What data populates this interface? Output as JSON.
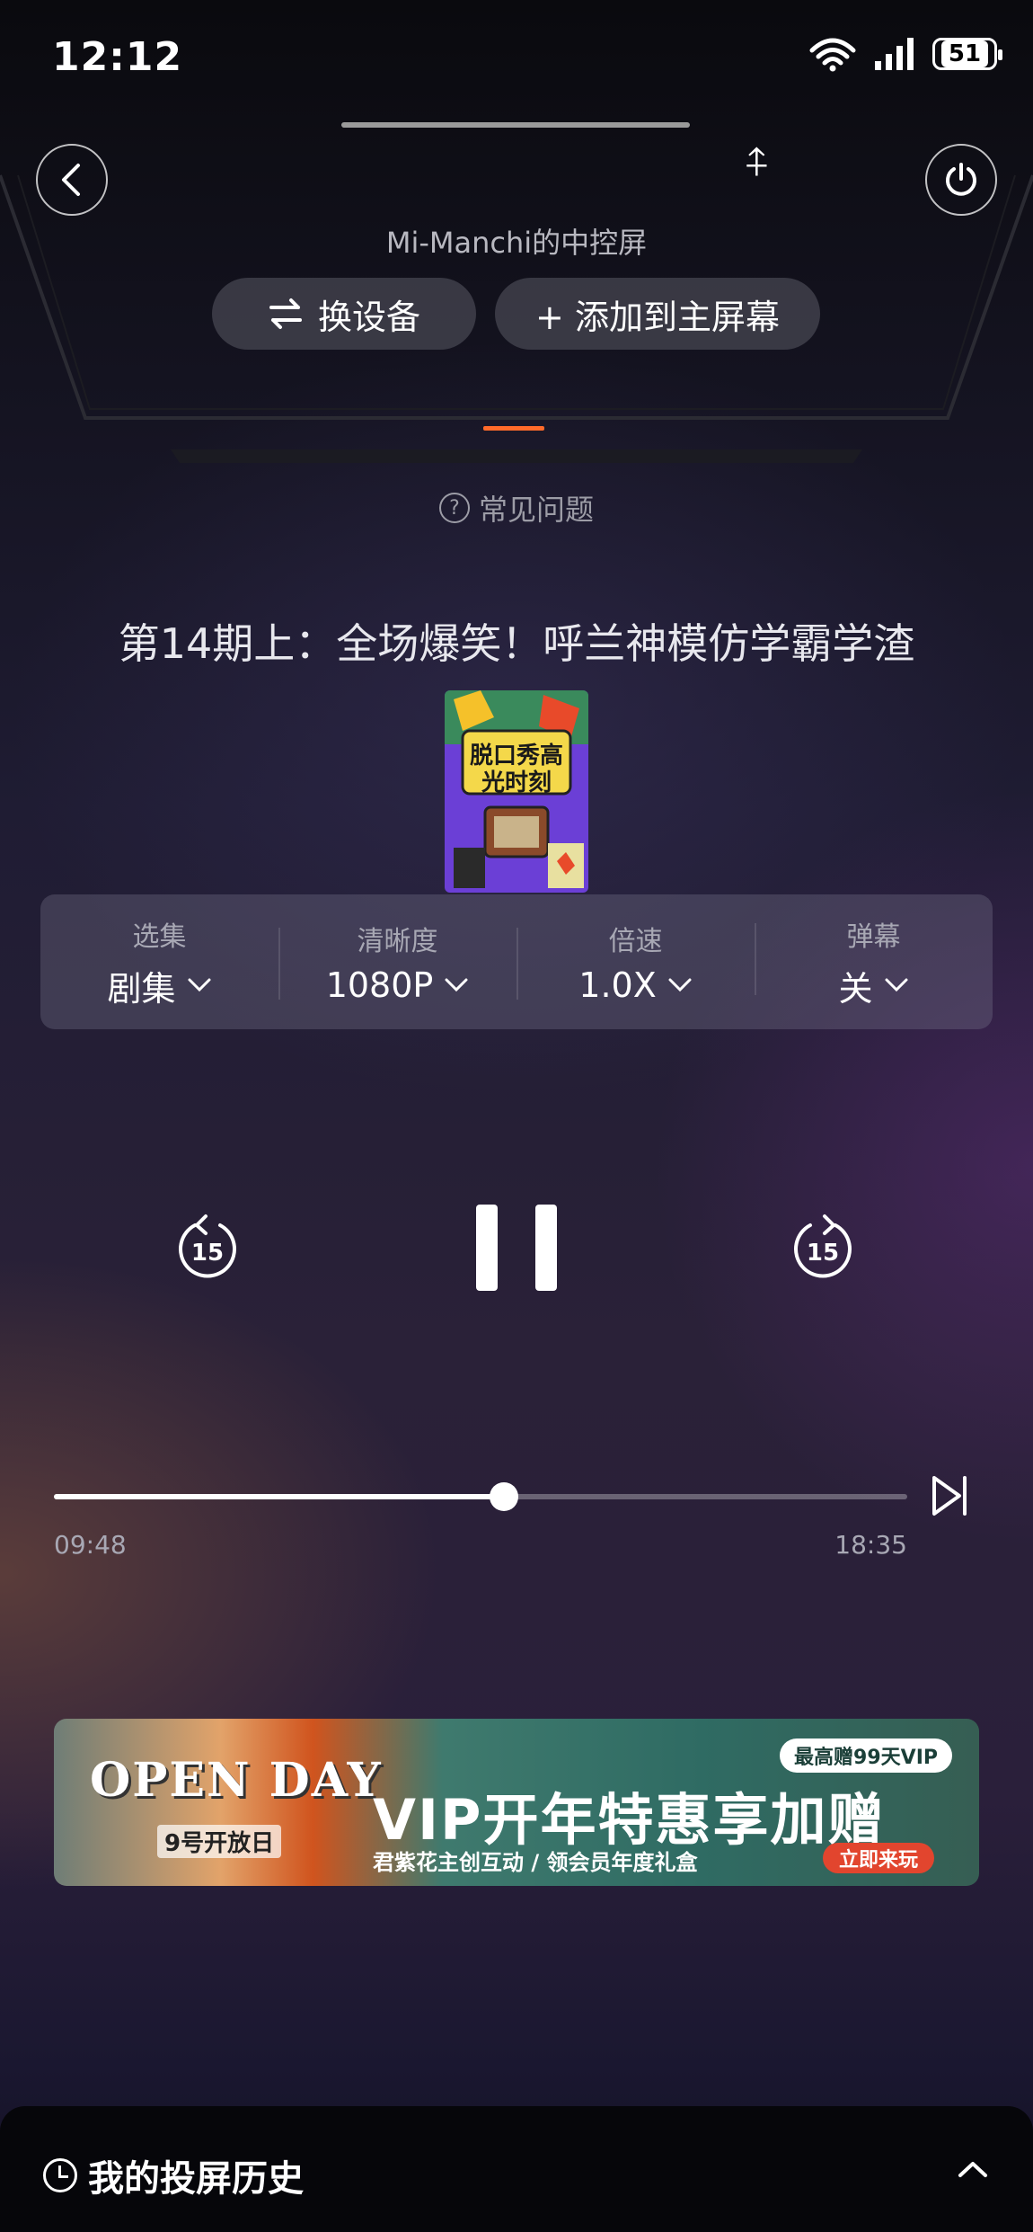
{
  "status_bar": {
    "time": "12:12",
    "battery": "51"
  },
  "header": {
    "device_name": "Mi-Manchi的中控屏",
    "switch_device_label": "换设备",
    "add_to_home_label": "+ 添加到主屏幕",
    "faq_label": "常见问题",
    "bluetooth_glyph": "⍏"
  },
  "episode": {
    "title": "第14期上：全场爆笑！呼兰神模仿学霸学渣",
    "cover_text": "脱口秀高光时刻"
  },
  "settings": [
    {
      "label": "选集",
      "value": "剧集"
    },
    {
      "label": "清晰度",
      "value": "1080P"
    },
    {
      "label": "倍速",
      "value": "1.0X"
    },
    {
      "label": "弹幕",
      "value": "关"
    }
  ],
  "controls": {
    "rewind_seconds": "15",
    "forward_seconds": "15",
    "state": "playing"
  },
  "progress": {
    "current": "09:48",
    "total": "18:35",
    "fraction": 0.527
  },
  "banner": {
    "logo": "OPEN DAY",
    "logo_sub": "9号开放日",
    "badge": "最高赠99天VIP",
    "headline": "VIP开年特惠享加赠",
    "subline": "君紫花主创互动 / 领会员年度礼盒",
    "cta": "立即来玩"
  },
  "history": {
    "label": "我的投屏历史"
  },
  "colors": {
    "accent_orange": "#ff6a2a"
  }
}
